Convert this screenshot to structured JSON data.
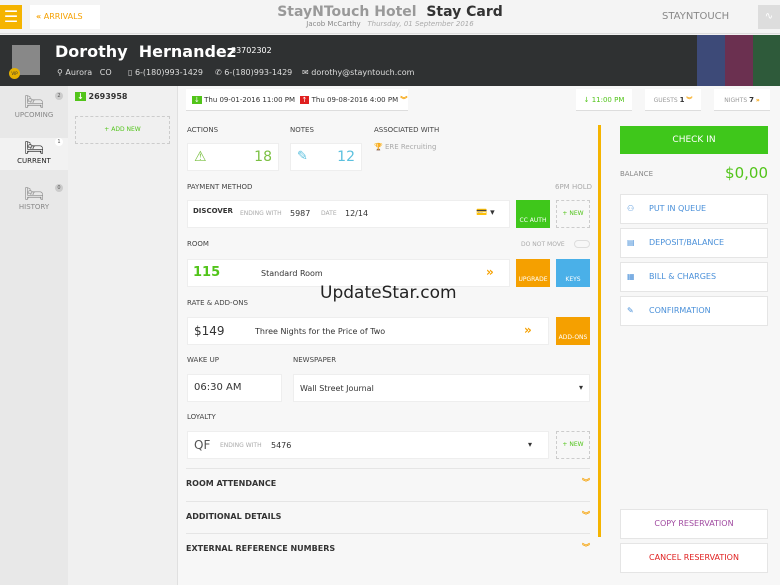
{
  "header": {
    "menu_icon": "hamburger-icon",
    "back_label": "ARRIVALS",
    "hotel": "StayNTouch Hotel",
    "title": "Stay Card",
    "user": "Jacob McCarthy",
    "date": "Thursday, 01 September 2016",
    "logo": "STAYNTOUCH"
  },
  "guest": {
    "first": "Dorothy",
    "last": "Hernandez",
    "id": "33702302",
    "vip": "VIP",
    "city": "Aurora",
    "state": "CO",
    "mobile": "6-(180)993-1429",
    "phone": "6-(180)993-1429",
    "email": "dorothy@stayntouch.com"
  },
  "sidebar": [
    {
      "label": "UPCOMING",
      "count": "2"
    },
    {
      "label": "CURRENT",
      "count": "1"
    },
    {
      "label": "HISTORY",
      "count": "0"
    }
  ],
  "reservation": {
    "number": "2693958",
    "add_new": "+ ADD NEW"
  },
  "dates": {
    "arrival": "Thu 09-01-2016 11:00 PM",
    "departure": "Thu 09-08-2016 4:00 PM",
    "eta": "11:00 PM",
    "guests_label": "GUESTS",
    "guests": "1",
    "nights_label": "NIGHTS",
    "nights": "7"
  },
  "actions": {
    "label": "ACTIONS",
    "count": "18"
  },
  "notes": {
    "label": "NOTES",
    "count": "12"
  },
  "associated": {
    "label": "ASSOCIATED WITH",
    "value": "ERE Recruiting"
  },
  "payment": {
    "label": "PAYMENT METHOD",
    "hold": "6PM HOLD",
    "card": "DISCOVER",
    "ending_label": "ENDING WITH",
    "ending": "5987",
    "date_label": "DATE",
    "date": "12/14",
    "cc_auth": "CC AUTH",
    "new": "+ NEW"
  },
  "room": {
    "label": "ROOM",
    "do_not_move": "DO NOT MOVE",
    "number": "115",
    "type": "Standard Room",
    "upgrade": "UPGRADE",
    "keys": "KEYS"
  },
  "rate": {
    "label": "RATE & ADD-ONS",
    "amount": "$149",
    "name": "Three Nights for the Price of Two",
    "addons": "ADD-ONS"
  },
  "wakeup": {
    "label": "WAKE UP",
    "value": "06:30 AM"
  },
  "newspaper": {
    "label": "NEWSPAPER",
    "value": "Wall Street Journal"
  },
  "loyalty": {
    "label": "LOYALTY",
    "program": "QF",
    "ending_label": "ENDING WITH",
    "ending": "5476",
    "new": "+ NEW"
  },
  "sections": [
    "ROOM ATTENDANCE",
    "ADDITIONAL DETAILS",
    "EXTERNAL REFERENCE NUMBERS"
  ],
  "right": {
    "check_in": "CHECK IN",
    "balance_label": "BALANCE",
    "balance": "$0,00",
    "items": [
      "PUT IN QUEUE",
      "DEPOSIT/BALANCE",
      "BILL & CHARGES",
      "CONFIRMATION"
    ],
    "copy": "COPY RESERVATION",
    "cancel": "CANCEL RESERVATION"
  },
  "watermark": "UpdateStar.com",
  "colors": {
    "accent": "#f5a000",
    "green": "#52c41a",
    "blue": "#4a90d9",
    "red": "#e02020"
  }
}
